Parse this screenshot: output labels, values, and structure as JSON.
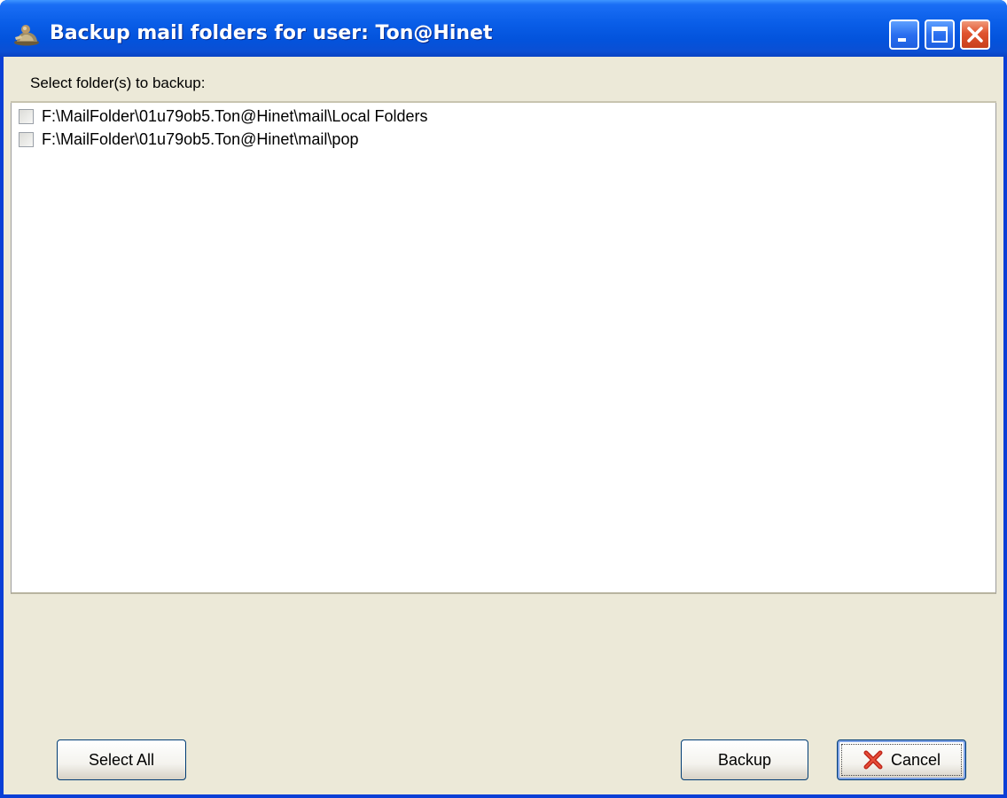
{
  "window": {
    "title": "Backup mail folders for user: Ton@Hinet",
    "icon": "user-icon",
    "controls": {
      "minimize_icon": "minimize-icon",
      "maximize_icon": "maximize-icon",
      "close_icon": "close-icon"
    }
  },
  "header": {
    "label": "Select folder(s) to backup:"
  },
  "folders": [
    {
      "path": "F:\\MailFolder\\01u79ob5.Ton@Hinet\\mail\\Local Folders",
      "checked": false
    },
    {
      "path": "F:\\MailFolder\\01u79ob5.Ton@Hinet\\mail\\pop",
      "checked": false
    }
  ],
  "buttons": {
    "select_all": "Select All",
    "backup": "Backup",
    "cancel": "Cancel",
    "cancel_icon": "red-x-icon"
  },
  "colors": {
    "titlebar": "#0353dc",
    "dialog_bg": "#ece9d8",
    "close_button": "#e0532e",
    "cancel_x": "#c0271a"
  }
}
